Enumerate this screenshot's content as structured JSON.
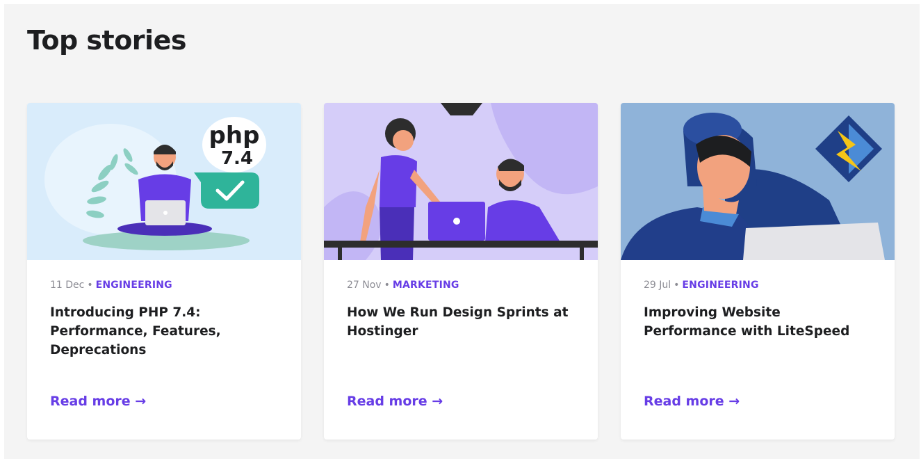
{
  "section": {
    "title": "Top stories"
  },
  "colors": {
    "accent": "#673de6",
    "background": "#f4f4f4",
    "text": "#1d1e20",
    "muted": "#8c8c94"
  },
  "cards": [
    {
      "date": "11 Dec",
      "separator": "•",
      "category": "ENGINEERING",
      "title": "Introducing PHP 7.4: Performance, Features, Deprecations",
      "link": "Read more →",
      "image": {
        "description_icon": "php-illustration",
        "php_text": "php",
        "version_text": "7.4"
      }
    },
    {
      "date": "27 Nov",
      "separator": "•",
      "category": "MARKETING",
      "title": "How We Run Design Sprints at Hostinger",
      "link": "Read more →",
      "image": {
        "description_icon": "design-sprint-illustration"
      }
    },
    {
      "date": "29 Jul",
      "separator": "•",
      "category": "ENGINEERING",
      "title": "Improving Website Performance with LiteSpeed",
      "link": "Read more →",
      "image": {
        "description_icon": "litespeed-illustration"
      }
    }
  ]
}
